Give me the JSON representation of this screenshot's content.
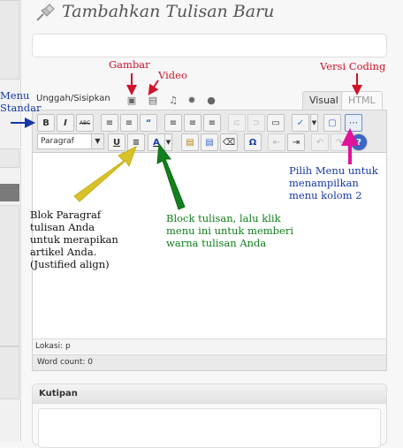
{
  "page": {
    "title": "Tambahkan Tulisan Baru",
    "upload_label": "Unggah/Sisipkan",
    "tabs": [
      {
        "label": "Visual",
        "active": true
      },
      {
        "label": "HTML",
        "active": false
      }
    ]
  },
  "toolbar": {
    "row1": [
      {
        "name": "bold-button",
        "label": "B"
      },
      {
        "name": "italic-button",
        "label": "I"
      },
      {
        "name": "strikethrough-button",
        "label": "ABC"
      },
      {
        "name": "bullet-list-button",
        "label": "≡"
      },
      {
        "name": "numbered-list-button",
        "label": "≡"
      },
      {
        "name": "blockquote-button",
        "label": "“"
      },
      {
        "name": "align-left-button",
        "label": "≡"
      },
      {
        "name": "align-center-button",
        "label": "≡"
      },
      {
        "name": "align-right-button",
        "label": "≡"
      },
      {
        "name": "insert-link-button",
        "label": "⊂"
      },
      {
        "name": "unlink-button",
        "label": "⊃"
      },
      {
        "name": "insert-more-button",
        "label": "▭"
      },
      {
        "name": "spellcheck-button",
        "label": "✓"
      },
      {
        "name": "fullscreen-button",
        "label": "▢"
      },
      {
        "name": "kitchen-sink-button",
        "label": "⋯"
      }
    ],
    "format_select": "Paragraf",
    "row2": [
      {
        "name": "underline-button",
        "label": "U"
      },
      {
        "name": "justify-button",
        "label": "≡"
      },
      {
        "name": "text-color-button",
        "label": "A"
      },
      {
        "name": "paste-text-button",
        "label": "▤"
      },
      {
        "name": "paste-word-button",
        "label": "▤"
      },
      {
        "name": "remove-format-button",
        "label": "⌫"
      },
      {
        "name": "special-char-button",
        "label": "Ω"
      },
      {
        "name": "outdent-button",
        "label": "⇤"
      },
      {
        "name": "indent-button",
        "label": "⇥"
      },
      {
        "name": "undo-button",
        "label": "↶"
      },
      {
        "name": "redo-button",
        "label": "↷"
      },
      {
        "name": "help-button",
        "label": "?"
      }
    ]
  },
  "editor": {
    "path_label": "Lokasi: p",
    "word_count": "Word count: 0"
  },
  "kutipan": {
    "title": "Kutipan"
  },
  "annotations": {
    "gambar": "Gambar",
    "video": "Video",
    "versi_coding": "Versi Coding",
    "menu_standar": [
      "Menu",
      "Standar"
    ],
    "pilih_menu": [
      "Pilih Menu untuk",
      "menampilkan",
      "menu kolom 2"
    ],
    "blok_paragraf": [
      "Blok Paragraf",
      "tulisan Anda",
      "untuk merapikan",
      "artikel Anda.",
      "(Justified align)"
    ],
    "block_tulisan": [
      "Block tulisan, lalu klik",
      "menu ini untuk memberi",
      "warna tulisan Anda"
    ]
  },
  "colors": {
    "annotation_red": "#d0122a",
    "annotation_blue": "#1638a8",
    "annotation_green": "#11801d",
    "annotation_magenta": "#e0139b",
    "annotation_yellow": "#d8c22a"
  }
}
